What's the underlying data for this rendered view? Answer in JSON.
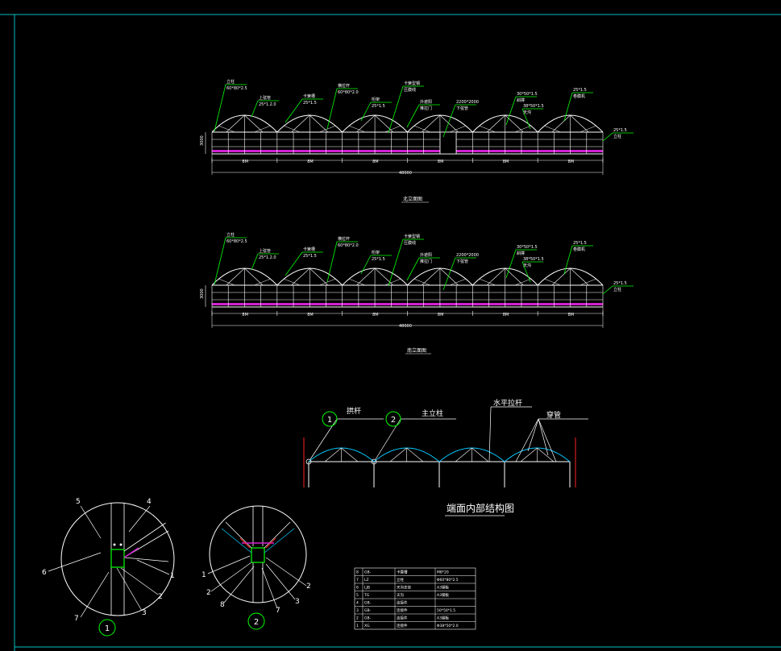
{
  "elevation1": {
    "title": "北立面图",
    "callouts": [
      "立柱",
      "60*80*2.5",
      "上弦管",
      "25*1.2.0",
      "卡簧槽",
      "25*1.5",
      "横拉杆",
      "60*80*2.0",
      "桁架",
      "25*1.5",
      "卡簧型钢",
      "压膜线",
      "外遮阳",
      "推拉门",
      "2200*2000",
      "下弦管",
      "30*50*1.5",
      "斜撑",
      "38*50*1.5",
      "天沟",
      "25*1.5",
      "卷膜机",
      "25*1.5"
    ],
    "height_dim": "3000",
    "bay_dims": [
      "8M",
      "8M",
      "8M",
      "8M",
      "8M",
      "8M"
    ],
    "total_dim": "48000"
  },
  "elevation2": {
    "title": "南立面图",
    "height_dim": "3000",
    "bay_dims": [
      "8M",
      "8M",
      "8M",
      "8M",
      "8M",
      "8M"
    ],
    "total_dim": "48000"
  },
  "section": {
    "title": "端面内部结构图",
    "labels": [
      "拱杆",
      "主立柱",
      "水平拉杆",
      "穿管"
    ],
    "markers": [
      "1",
      "2"
    ]
  },
  "detail1": {
    "marker": "1",
    "parts": [
      "5",
      "4",
      "6",
      "1",
      "2",
      "7",
      "3"
    ]
  },
  "detail2": {
    "marker": "2",
    "parts": [
      "1",
      "2",
      "8",
      "7",
      "3",
      "2"
    ]
  },
  "table": {
    "rows": [
      [
        "8",
        "GB-",
        "卡簧槽",
        "M8*20"
      ],
      [
        "7",
        "LZ",
        "立柱",
        "Φ60*80*2.5"
      ],
      [
        "6",
        "LJB",
        "天沟支架",
        "A3钢板"
      ],
      [
        "5",
        "TG",
        "天沟",
        "A3钢板"
      ],
      [
        "4",
        "GB-",
        "连接件",
        ""
      ],
      [
        "3",
        "GB-",
        "连接件",
        "50*50*1.5"
      ],
      [
        "2",
        "GB-",
        "连接件",
        "A3钢板"
      ],
      [
        "1",
        "XG",
        "连接件",
        "Φ38*50*2.0"
      ]
    ]
  }
}
